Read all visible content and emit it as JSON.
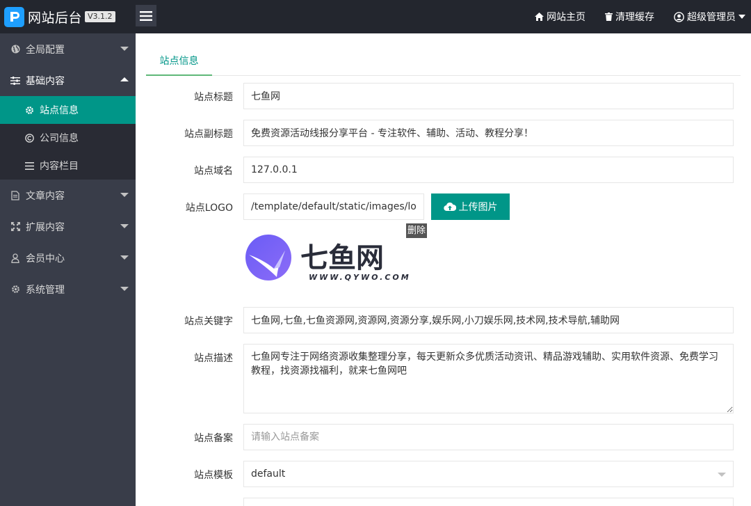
{
  "header": {
    "app_title": "网站后台",
    "version": "V3.1.2",
    "nav": {
      "home": "网站主页",
      "clear_cache": "清理缓存",
      "admin": "超级管理员"
    }
  },
  "sidebar": {
    "items": [
      {
        "label": "全局配置",
        "icon": "globe-icon"
      },
      {
        "label": "基础内容",
        "icon": "sliders-icon",
        "expanded": true,
        "children": [
          {
            "label": "站点信息",
            "icon": "gear-icon",
            "active": true
          },
          {
            "label": "公司信息",
            "icon": "copyright-icon"
          },
          {
            "label": "内容栏目",
            "icon": "list-icon"
          }
        ]
      },
      {
        "label": "文章内容",
        "icon": "document-icon"
      },
      {
        "label": "扩展内容",
        "icon": "expand-icon"
      },
      {
        "label": "会员中心",
        "icon": "user-icon"
      },
      {
        "label": "系统管理",
        "icon": "gear-icon"
      }
    ]
  },
  "tab": {
    "label": "站点信息"
  },
  "form": {
    "title": {
      "label": "站点标题",
      "value": "七鱼网"
    },
    "subtitle": {
      "label": "站点副标题",
      "value": "免费资源活动线报分享平台 - 专注软件、辅助、活动、教程分享！"
    },
    "domain": {
      "label": "站点域名",
      "value": "127.0.0.1"
    },
    "logo": {
      "label": "站点LOGO",
      "value": "/template/default/static/images/logo.png",
      "upload_label": "上传图片",
      "delete_label": "删除"
    },
    "keywords": {
      "label": "站点关键字",
      "value": "七鱼网,七鱼,七鱼资源网,资源网,资源分享,娱乐网,小刀娱乐网,技术网,技术导航,辅助网"
    },
    "description": {
      "label": "站点描述",
      "value": "七鱼网专注于网络资源收集整理分享，每天更新众多优质活动资讯、精品游戏辅助、实用软件资源、免费学习教程，找资源找福利，就来七鱼网吧"
    },
    "icp": {
      "label": "站点备案",
      "placeholder": "请输入站点备案"
    },
    "template": {
      "label": "站点模板",
      "value": "default"
    }
  },
  "logo_image": {
    "name": "七鱼网",
    "url_text": "WWW.QYWO.COM"
  },
  "colors": {
    "accent": "#009688",
    "header_bg": "#23262e",
    "sidebar_bg": "#393d49",
    "submenu_bg": "#292b34"
  }
}
